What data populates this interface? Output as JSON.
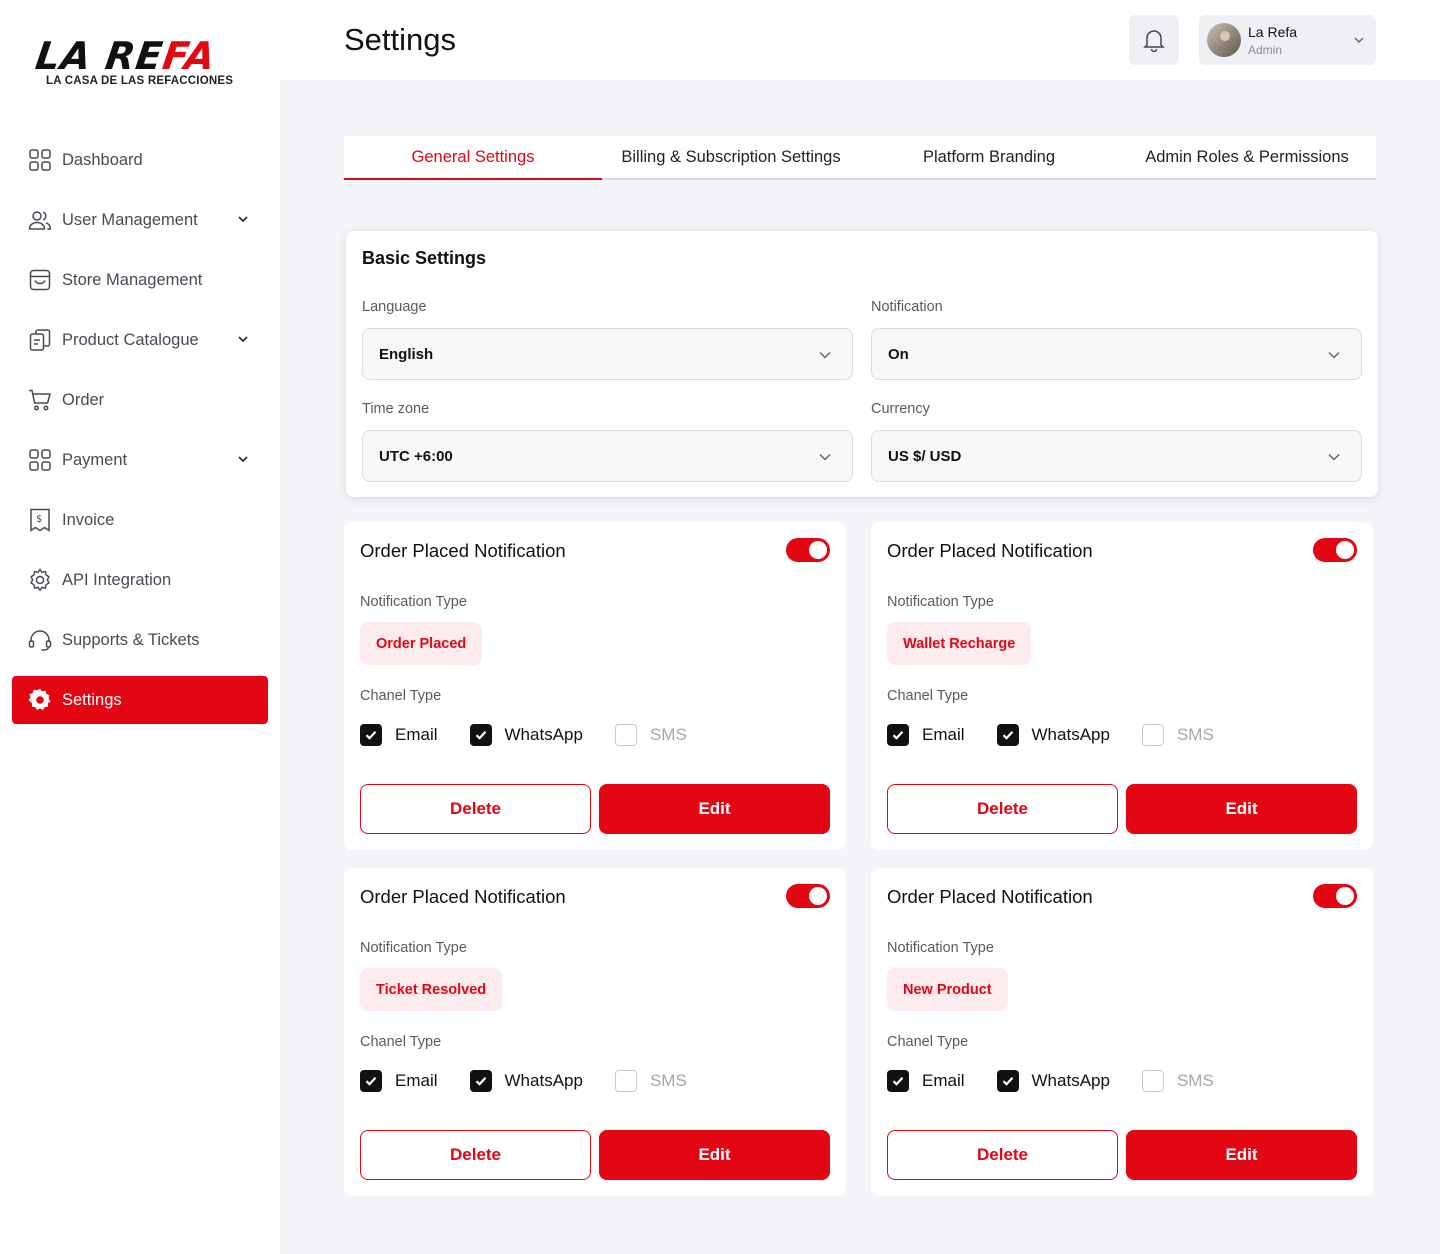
{
  "brand": {
    "name_black": "LA RE",
    "name_red": "FA",
    "tagline": "LA CASA DE LAS REFACCIONES"
  },
  "sidebar": {
    "items": [
      {
        "label": "Dashboard",
        "icon": "dashboard-grid-icon",
        "chevron": false,
        "active": false
      },
      {
        "label": "User Management",
        "icon": "users-icon",
        "chevron": true,
        "active": false
      },
      {
        "label": "Store Management",
        "icon": "store-icon",
        "chevron": false,
        "active": false
      },
      {
        "label": "Product Catalogue",
        "icon": "catalogue-icon",
        "chevron": true,
        "active": false
      },
      {
        "label": "Order",
        "icon": "cart-icon",
        "chevron": false,
        "active": false
      },
      {
        "label": "Payment",
        "icon": "payment-grid-icon",
        "chevron": true,
        "active": false
      },
      {
        "label": "Invoice",
        "icon": "invoice-icon",
        "chevron": false,
        "active": false
      },
      {
        "label": "API Integration",
        "icon": "api-gear-icon",
        "chevron": false,
        "active": false
      },
      {
        "label": "Supports & Tickets",
        "icon": "headset-icon",
        "chevron": false,
        "active": false
      },
      {
        "label": "Settings",
        "icon": "settings-gear-icon",
        "chevron": false,
        "active": true
      }
    ]
  },
  "header": {
    "title": "Settings",
    "user": {
      "name": "La Refa",
      "role": "Admin"
    }
  },
  "tabs": [
    {
      "label": "General Settings",
      "active": true
    },
    {
      "label": "Billing & Subscription Settings",
      "active": false
    },
    {
      "label": "Platform Branding",
      "active": false
    },
    {
      "label": "Admin Roles & Permissions",
      "active": false
    }
  ],
  "basic_settings": {
    "title": "Basic Settings",
    "language": {
      "label": "Language",
      "value": "English"
    },
    "notification": {
      "label": "Notification",
      "value": "On"
    },
    "timezone": {
      "label": "Time zone",
      "value": "UTC +6:00"
    },
    "currency": {
      "label": "Currency",
      "value": "US $/ USD"
    }
  },
  "notification_cards": [
    {
      "title": "Order Placed Notification",
      "enabled": true,
      "type_label": "Notification Type",
      "type": "Order Placed",
      "channel_label": "Chanel Type",
      "email": "Email",
      "whatsapp": "WhatsApp",
      "sms": "SMS",
      "delete": "Delete",
      "edit": "Edit"
    },
    {
      "title": "Order Placed Notification",
      "enabled": true,
      "type_label": "Notification Type",
      "type": "Wallet Recharge",
      "channel_label": "Chanel Type",
      "email": "Email",
      "whatsapp": "WhatsApp",
      "sms": "SMS",
      "delete": "Delete",
      "edit": "Edit"
    },
    {
      "title": "Order Placed Notification",
      "enabled": true,
      "type_label": "Notification Type",
      "type": "Ticket Resolved",
      "channel_label": "Chanel Type",
      "email": "Email",
      "whatsapp": "WhatsApp",
      "sms": "SMS",
      "delete": "Delete",
      "edit": "Edit"
    },
    {
      "title": "Order Placed Notification",
      "enabled": true,
      "type_label": "Notification Type",
      "type": "New Product",
      "channel_label": "Chanel Type",
      "email": "Email",
      "whatsapp": "WhatsApp",
      "sms": "SMS",
      "delete": "Delete",
      "edit": "Edit"
    }
  ],
  "colors": {
    "accent": "#e30613",
    "badge_bg": "#fdecee",
    "page_bg": "#f4f5f8"
  }
}
